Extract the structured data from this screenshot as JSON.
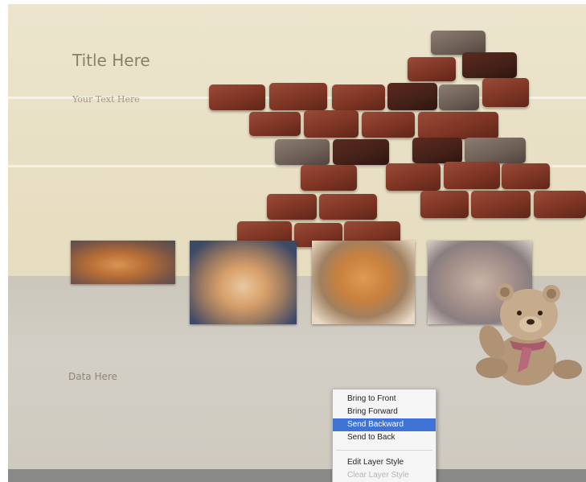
{
  "slide": {
    "title": "Title Here",
    "subtitle": "Your Text Here",
    "data_label": "Data Here"
  },
  "context_menu": {
    "items": [
      {
        "label": "Bring to Front",
        "state": "normal"
      },
      {
        "label": "Bring Forward",
        "state": "normal"
      },
      {
        "label": "Send Backward",
        "state": "highlighted"
      },
      {
        "label": "Send to Back",
        "state": "normal"
      },
      {
        "label": "Edit Layer Style",
        "state": "normal"
      },
      {
        "label": "Clear Layer Style",
        "state": "disabled"
      }
    ]
  },
  "photos": [
    "kitten-photo",
    "kitten-photo",
    "kitten-photo",
    "kitten-photo"
  ],
  "colors": {
    "paper": "#e9e1c7",
    "plaster": "#cfcac0",
    "brick": "#7e3524",
    "menu_highlight": "#3f73d6",
    "bottom_bar": "#8a8a89"
  }
}
